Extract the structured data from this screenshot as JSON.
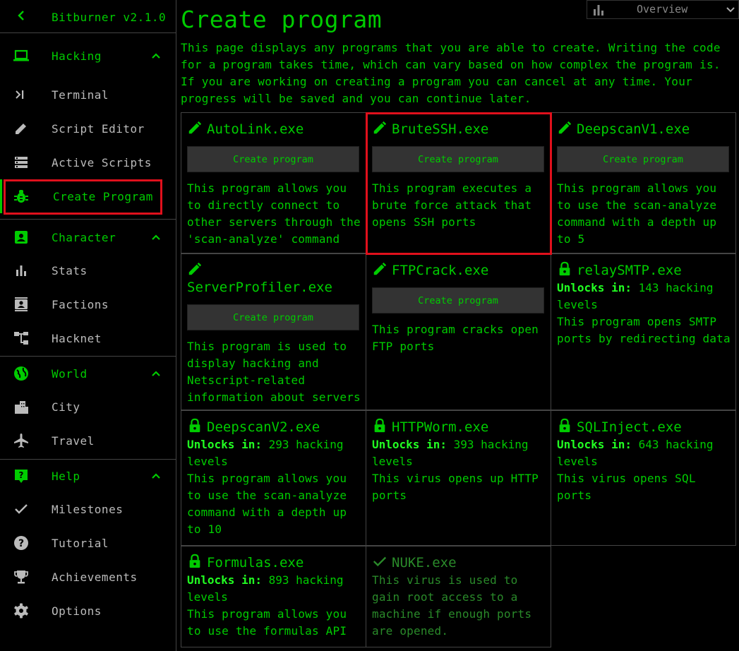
{
  "sidebar": {
    "title": "Bitburner v2.1.0",
    "categories": {
      "hacking": "Hacking",
      "character": "Character",
      "world": "World",
      "help": "Help"
    },
    "items": {
      "terminal": "Terminal",
      "script_editor": "Script Editor",
      "active_scripts": "Active Scripts",
      "create_program": "Create Program",
      "stats": "Stats",
      "factions": "Factions",
      "hacknet": "Hacknet",
      "city": "City",
      "travel": "Travel",
      "milestones": "Milestones",
      "tutorial": "Tutorial",
      "achievements": "Achievements",
      "options": "Options"
    }
  },
  "overview": {
    "label": "Overview"
  },
  "main": {
    "title": "Create program",
    "intro": "This page displays any programs that you are able to create. Writing the code for a program takes time, which can vary based on how complex the program is. If you are working on creating a program you can cancel at any time. Your progress will be saved and you can continue later.",
    "button_label": "Create program",
    "unlock_prefix": "Unlocks in:",
    "programs": [
      {
        "name": "AutoLink.exe",
        "status": "available",
        "desc": "This program allows you to directly connect to other servers through the 'scan-analyze' command"
      },
      {
        "name": "BruteSSH.exe",
        "status": "available",
        "desc": "This program executes a brute force attack that opens SSH ports"
      },
      {
        "name": "DeepscanV1.exe",
        "status": "available",
        "desc": "This program allows you to use the scan-analyze command with a depth up to 5"
      },
      {
        "name": "ServerProfiler.exe",
        "status": "available",
        "desc": "This program is used to display hacking and Netscript-related information about servers"
      },
      {
        "name": "FTPCrack.exe",
        "status": "available",
        "desc": "This program cracks open FTP ports"
      },
      {
        "name": "relaySMTP.exe",
        "status": "locked",
        "unlock": "143 hacking levels",
        "desc": "This program opens SMTP ports by redirecting data"
      },
      {
        "name": "DeepscanV2.exe",
        "status": "locked",
        "unlock": "293 hacking levels",
        "desc": "This program allows you to use the scan-analyze command with a depth up to 10"
      },
      {
        "name": "HTTPWorm.exe",
        "status": "locked",
        "unlock": "393 hacking levels",
        "desc": "This virus opens up HTTP ports"
      },
      {
        "name": "SQLInject.exe",
        "status": "locked",
        "unlock": "643 hacking levels",
        "desc": "This virus opens SQL ports"
      },
      {
        "name": "Formulas.exe",
        "status": "locked",
        "unlock": "893 hacking levels",
        "desc": "This program allows you to use the formulas API"
      },
      {
        "name": "NUKE.exe",
        "status": "done",
        "desc": "This virus is used to gain root access to a machine if enough ports are opened."
      }
    ]
  },
  "colors": {
    "accent": "#00cc00",
    "highlight": "#e0101c",
    "panel_border": "#444444",
    "button_bg": "#333333"
  }
}
